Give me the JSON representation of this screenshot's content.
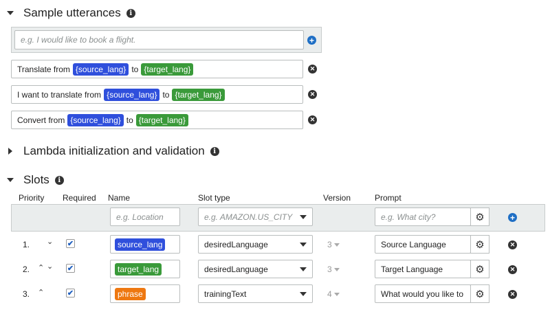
{
  "utterances": {
    "title": "Sample utterances",
    "input_placeholder": "e.g. I would like to book a flight.",
    "items": [
      {
        "prefix": "Translate from",
        "slot1": "{source_lang}",
        "mid": "to",
        "slot2": "{target_lang}"
      },
      {
        "prefix": "I want to translate from",
        "slot1": "{source_lang}",
        "mid": "to",
        "slot2": "{target_lang}"
      },
      {
        "prefix": "Convert from",
        "slot1": "{source_lang}",
        "mid": "to",
        "slot2": "{target_lang}"
      }
    ]
  },
  "lambda": {
    "title": "Lambda initialization and validation"
  },
  "slots": {
    "title": "Slots",
    "columns": {
      "priority": "Priority",
      "required": "Required",
      "name": "Name",
      "slot_type": "Slot type",
      "version": "Version",
      "prompt": "Prompt"
    },
    "new_row": {
      "name_placeholder": "e.g. Location",
      "type_placeholder": "e.g. AMAZON.US_CITY",
      "prompt_placeholder": "e.g. What city?"
    },
    "rows": [
      {
        "priority": "1.",
        "required": true,
        "name": "source_lang",
        "name_color": "#2f4fdc",
        "slot_type": "desiredLanguage",
        "version": "3",
        "prompt": "Source Language"
      },
      {
        "priority": "2.",
        "required": true,
        "name": "target_lang",
        "name_color": "#3a9a3a",
        "slot_type": "desiredLanguage",
        "version": "3",
        "prompt": "Target Language"
      },
      {
        "priority": "3.",
        "required": true,
        "name": "phrase",
        "name_color": "#ee7811",
        "slot_type": "trainingText",
        "version": "4",
        "prompt": "What would you like to"
      }
    ]
  },
  "icons": {
    "info": "i",
    "plus": "+",
    "remove": "✕",
    "check": "✔",
    "gear": "⚙",
    "chevron_up": "⌃",
    "chevron_down": "⌄"
  }
}
